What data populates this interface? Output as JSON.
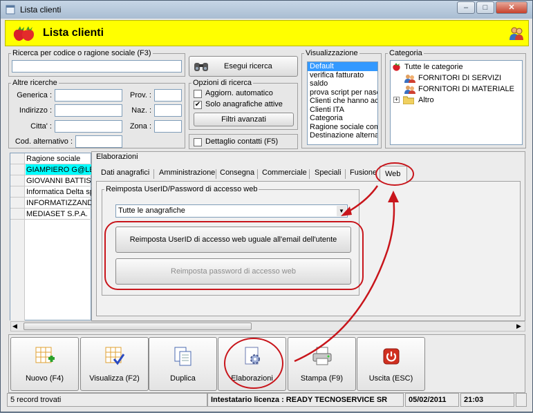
{
  "window": {
    "title": "Lista clienti"
  },
  "header": {
    "title": "Lista clienti"
  },
  "search": {
    "legend": "Ricerca per codice o ragione sociale (F3)",
    "value": "",
    "execute_label": "Esegui ricerca"
  },
  "other": {
    "legend": "Altre ricerche",
    "generica": "Generica :",
    "indirizzo": "Indirizzo :",
    "citta": "Citta' :",
    "cod_alt": "Cod. alternativo :",
    "prov": "Prov. :",
    "naz": "Naz. :",
    "zona": "Zona :"
  },
  "options": {
    "legend": "Opzioni di ricerca",
    "auto": "Aggiorn. automatico",
    "solo": "Solo anagrafiche attive",
    "filtri": "Filtri avanzati",
    "dettaglio": "Dettaglio contatti (F5)"
  },
  "view": {
    "legend": "Visualizzazione",
    "items": [
      "Default",
      "verifica fatturato",
      "saldo",
      "prova script per nasc",
      "Clienti che hanno acc",
      "Clienti ITA",
      "Categoria",
      "Ragione sociale com",
      "Destinazione alternat"
    ]
  },
  "category": {
    "legend": "Categoria",
    "root": "Tutte le categorie",
    "items": [
      "FORNITORI DI SERVIZI",
      "FORNITORI DI MATERIALE",
      "Altro"
    ]
  },
  "grid": {
    "header": "Ragione sociale",
    "rows": [
      "GIAMPIERO G@LE",
      "GIOVANNI BATTIS",
      "Informatica Delta sp",
      "INFORMATIZZAND",
      "MEDIASET S.P.A."
    ]
  },
  "elab": {
    "legend": "Elaborazioni",
    "tabs": [
      "Dati anagrafici",
      "Amministrazione",
      "Consegna",
      "Commerciale",
      "Speciali",
      "Fusione",
      "Web"
    ],
    "group": "Reimposta UserID/Password di accesso web",
    "combo": "Tutte le anagrafiche",
    "btn_user": "Reimposta UserID di accesso web uguale all'email dell'utente",
    "btn_pass": "Reimposta password di accesso web"
  },
  "toolbar": {
    "nuovo": "Nuovo (F4)",
    "visualizza": "Visualizza (F2)",
    "duplica": "Duplica",
    "elaborazioni": "Elaborazioni",
    "stampa": "Stampa (F9)",
    "uscita": "Uscita (ESC)"
  },
  "status": {
    "records": "5 record trovati",
    "license": "Intestatario licenza : READY TECNOSERVICE SR",
    "date": "05/02/2011",
    "time": "21:03"
  }
}
